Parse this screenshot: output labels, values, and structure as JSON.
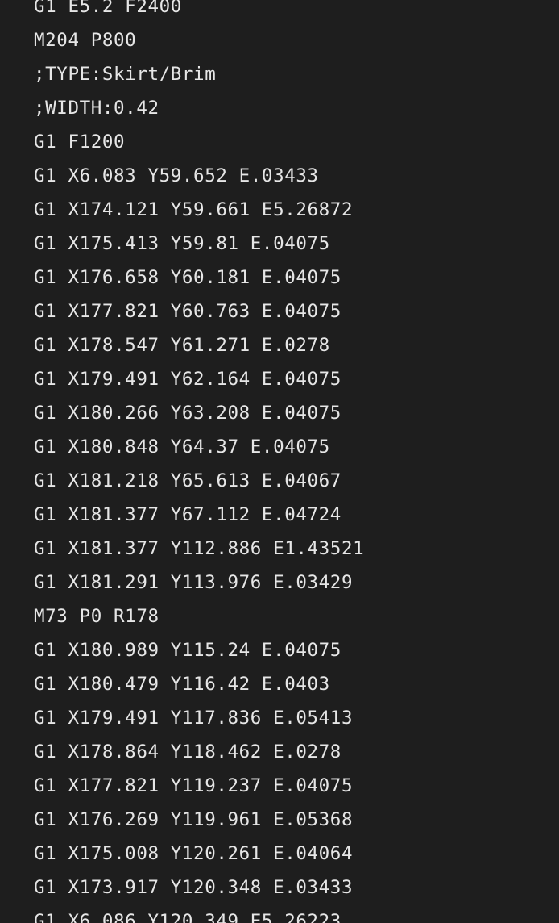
{
  "editor": {
    "lines": [
      "G1 E5.2 F2400",
      "M204 P800",
      ";TYPE:Skirt/Brim",
      ";WIDTH:0.42",
      "G1 F1200",
      "G1 X6.083 Y59.652 E.03433",
      "G1 X174.121 Y59.661 E5.26872",
      "G1 X175.413 Y59.81 E.04075",
      "G1 X176.658 Y60.181 E.04075",
      "G1 X177.821 Y60.763 E.04075",
      "G1 X178.547 Y61.271 E.0278",
      "G1 X179.491 Y62.164 E.04075",
      "G1 X180.266 Y63.208 E.04075",
      "G1 X180.848 Y64.37 E.04075",
      "G1 X181.218 Y65.613 E.04067",
      "G1 X181.377 Y67.112 E.04724",
      "G1 X181.377 Y112.886 E1.43521",
      "G1 X181.291 Y113.976 E.03429",
      "M73 P0 R178",
      "G1 X180.989 Y115.24 E.04075",
      "G1 X180.479 Y116.42 E.0403",
      "G1 X179.491 Y117.836 E.05413",
      "G1 X178.864 Y118.462 E.0278",
      "G1 X177.821 Y119.237 E.04075",
      "G1 X176.269 Y119.961 E.05368",
      "G1 X175.008 Y120.261 E.04064",
      "G1 X173.917 Y120.348 E.03433",
      "G1 X6.086 Y120.349 E5.26223"
    ],
    "colors": {
      "background": "#1e1e1e",
      "text": "#e6e6e6"
    }
  }
}
